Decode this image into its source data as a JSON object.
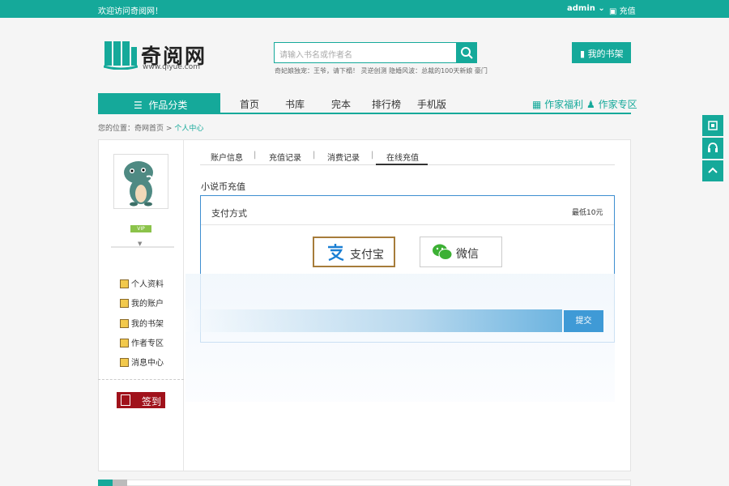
{
  "topbar": {
    "welcome": "欢迎访问奇阅网！",
    "user": "admin",
    "recharge": "充值"
  },
  "logo": {
    "name": "奇阅网",
    "url_text": "www.qiyue.com"
  },
  "search": {
    "placeholder": "请输入书名或作者名",
    "hot": "奇妃娘独宠：王爷，请下榻！ 灵逆创测 隐婚风波：总裁的100天新娘 豪门"
  },
  "header": {
    "shelf_label": "我的书架"
  },
  "nav": {
    "category": "作品分类",
    "items": [
      "首页",
      "书库",
      "完本",
      "排行榜",
      "手机版"
    ],
    "author_welfare": "作家福利",
    "author_zone": "作家专区"
  },
  "breadcrumb": {
    "prefix": "您的位置：",
    "home": "奇网首页",
    "sep": ">",
    "current": "个人中心"
  },
  "sidebar": {
    "vip_badge": "VIP",
    "menu": [
      "个人资料",
      "我的账户",
      "我的书架",
      "作者专区",
      "消息中心"
    ],
    "signin": "签到"
  },
  "tabs": [
    "账户信息",
    "充值记录",
    "消费记录",
    "在线充值"
  ],
  "recharge": {
    "title": "小说币充值",
    "pay_method_label": "支付方式",
    "min_amount": "最低10元",
    "options": [
      "支付宝",
      "微信"
    ],
    "submit": "提交"
  },
  "colors": {
    "brand": "#15a99a",
    "signin": "#a0121b",
    "submit": "#3f9ad6"
  },
  "float_icons": [
    "qrcode-icon",
    "service-icon",
    "back-to-top-icon"
  ]
}
